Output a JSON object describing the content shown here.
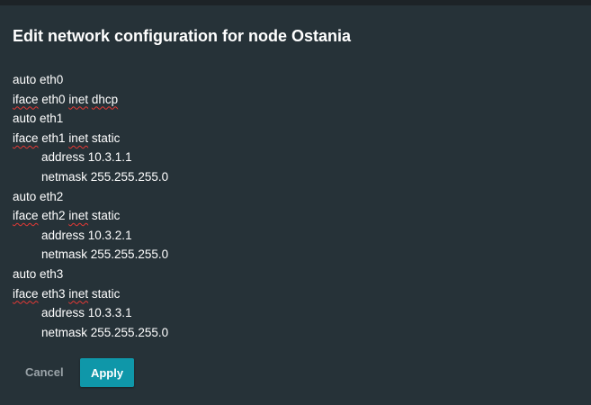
{
  "dialog": {
    "title": "Edit network configuration for node Ostania",
    "config_lines": [
      {
        "indent": false,
        "parts": [
          {
            "text": "auto eth0",
            "spell": false
          }
        ]
      },
      {
        "indent": false,
        "parts": [
          {
            "text": "iface",
            "spell": true
          },
          {
            "text": " eth0 ",
            "spell": false
          },
          {
            "text": "inet",
            "spell": true
          },
          {
            "text": " ",
            "spell": false
          },
          {
            "text": "dhcp",
            "spell": true
          }
        ]
      },
      {
        "indent": false,
        "parts": [
          {
            "text": "auto eth1",
            "spell": false
          }
        ]
      },
      {
        "indent": false,
        "parts": [
          {
            "text": "iface",
            "spell": true
          },
          {
            "text": " eth1 ",
            "spell": false
          },
          {
            "text": "inet",
            "spell": true
          },
          {
            "text": " static",
            "spell": false
          }
        ]
      },
      {
        "indent": true,
        "parts": [
          {
            "text": "address 10.3.1.1",
            "spell": false
          }
        ]
      },
      {
        "indent": true,
        "parts": [
          {
            "text": "netmask 255.255.255.0",
            "spell": false
          }
        ]
      },
      {
        "indent": false,
        "parts": [
          {
            "text": "auto eth2",
            "spell": false
          }
        ]
      },
      {
        "indent": false,
        "parts": [
          {
            "text": "iface",
            "spell": true
          },
          {
            "text": " eth2 ",
            "spell": false
          },
          {
            "text": "inet",
            "spell": true
          },
          {
            "text": " static",
            "spell": false
          }
        ]
      },
      {
        "indent": true,
        "parts": [
          {
            "text": "address 10.3.2.1",
            "spell": false
          }
        ]
      },
      {
        "indent": true,
        "parts": [
          {
            "text": "netmask 255.255.255.0",
            "spell": false
          }
        ]
      },
      {
        "indent": false,
        "parts": [
          {
            "text": "auto eth3",
            "spell": false
          }
        ]
      },
      {
        "indent": false,
        "parts": [
          {
            "text": "iface",
            "spell": true
          },
          {
            "text": " eth3 ",
            "spell": false
          },
          {
            "text": "inet",
            "spell": true
          },
          {
            "text": " static",
            "spell": false
          }
        ]
      },
      {
        "indent": true,
        "parts": [
          {
            "text": "address 10.3.3.1",
            "spell": false
          }
        ]
      },
      {
        "indent": true,
        "parts": [
          {
            "text": "netmask 255.255.255.0",
            "spell": false
          }
        ]
      }
    ],
    "cancel_label": "Cancel",
    "apply_label": "Apply"
  },
  "colors": {
    "background": "#263238",
    "accent": "#0f97a9",
    "spellcheck_underline": "#e53935",
    "muted_text": "#9aa3a8"
  }
}
